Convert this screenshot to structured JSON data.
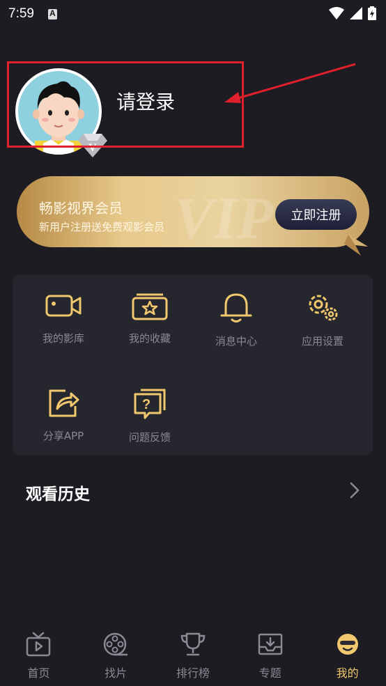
{
  "status_bar": {
    "time": "7:59"
  },
  "profile": {
    "login_label": "请登录"
  },
  "vip": {
    "title": "畅影视界会员",
    "subtitle": "新用户注册送免费观影会员",
    "register_label": "立即注册"
  },
  "menu": {
    "items": [
      {
        "label": "我的影库",
        "icon": "video-camera-icon"
      },
      {
        "label": "我的收藏",
        "icon": "favorites-icon"
      },
      {
        "label": "消息中心",
        "icon": "bell-icon"
      },
      {
        "label": "应用设置",
        "icon": "gear-icon"
      },
      {
        "label": "分享APP",
        "icon": "share-icon"
      },
      {
        "label": "问题反馈",
        "icon": "feedback-icon"
      }
    ]
  },
  "history": {
    "title": "观看历史"
  },
  "tabs": [
    {
      "label": "首页",
      "icon": "tv-icon"
    },
    {
      "label": "找片",
      "icon": "film-reel-icon"
    },
    {
      "label": "排行榜",
      "icon": "trophy-icon"
    },
    {
      "label": "专题",
      "icon": "topic-box-icon"
    },
    {
      "label": "我的",
      "icon": "smiley-face-icon",
      "active": true
    }
  ],
  "colors": {
    "accent": "#f1c86d",
    "background": "#1c1c22",
    "highlight": "#e0202a"
  }
}
